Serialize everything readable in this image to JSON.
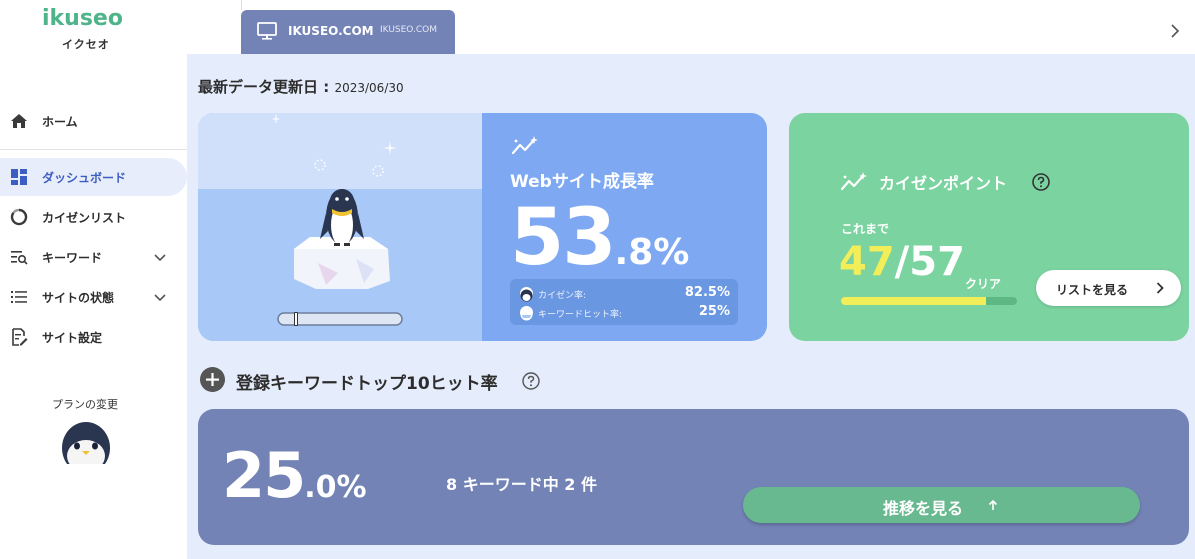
{
  "sidebar": {
    "brand": "ikuseo",
    "brand_kana": "イクセオ",
    "items": [
      {
        "label": "ホーム",
        "icon": "home-icon"
      },
      {
        "label": "ダッシュボード",
        "icon": "dashboard-icon",
        "active": true
      },
      {
        "label": "カイゼンリスト",
        "icon": "cycle-icon"
      },
      {
        "label": "キーワード",
        "icon": "keyword-search-icon",
        "expandable": true
      },
      {
        "label": "サイトの状態",
        "icon": "list-icon",
        "expandable": true
      },
      {
        "label": "サイト設定",
        "icon": "edit-doc-icon"
      }
    ],
    "plan_label": "プランの変更"
  },
  "site_tab": {
    "name": "IKUSEO.COM",
    "url": "IKUSEO.COM"
  },
  "main": {
    "updated_label": "最新データ更新日",
    "updated_sep": " : ",
    "updated_date": "2023/06/30",
    "growth": {
      "title": "Webサイト成長率",
      "value_int": "53",
      "value_dec": ".8%",
      "progress_value": 0.12,
      "rows": [
        {
          "label": "カイゼン率:",
          "value": "82.5%"
        },
        {
          "label": "キーワードヒット率:",
          "value": "25%"
        }
      ]
    },
    "kaizen": {
      "title": "カイゼンポイント",
      "so_far": "これまで",
      "done": "47",
      "slash": "/",
      "total": "57",
      "clear": "クリア",
      "progress_fraction": 0.8246,
      "button": "リストを見る"
    },
    "keywords": {
      "title": "登録キーワードトップ10ヒット率",
      "value_int": "25",
      "value_dec": ".0%",
      "stat": "8 キーワード中 2 件",
      "button": "推移を見る"
    }
  },
  "colors": {
    "growth_card": "#7ea9f2",
    "kaizen_card": "#7bd3a0",
    "keyword_card": "#7383b6",
    "accent_yellow": "#f2ee5a",
    "brand_green": "#4fb48a"
  }
}
